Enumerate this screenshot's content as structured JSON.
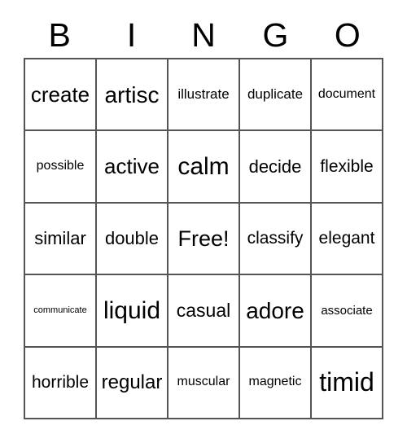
{
  "card": {
    "title_letters": [
      "B",
      "I",
      "N",
      "G",
      "O"
    ],
    "grid": {
      "columns": 5,
      "rows": 5,
      "border_color": "#555555",
      "background_color": "#ffffff",
      "text_color": "#000000",
      "cells": [
        [
          {
            "text": "create",
            "size": 26
          },
          {
            "text": "artisc",
            "size": 28
          },
          {
            "text": "illustrate",
            "size": 17
          },
          {
            "text": "duplicate",
            "size": 17
          },
          {
            "text": "document",
            "size": 16
          }
        ],
        [
          {
            "text": "possible",
            "size": 16
          },
          {
            "text": "active",
            "size": 26
          },
          {
            "text": "calm",
            "size": 30
          },
          {
            "text": "decide",
            "size": 22
          },
          {
            "text": "flexible",
            "size": 21
          }
        ],
        [
          {
            "text": "similar",
            "size": 22
          },
          {
            "text": "double",
            "size": 22
          },
          {
            "text": "Free!",
            "size": 27
          },
          {
            "text": "classify",
            "size": 21
          },
          {
            "text": "elegant",
            "size": 21
          }
        ],
        [
          {
            "text": "communicate",
            "size": 11
          },
          {
            "text": "liquid",
            "size": 30
          },
          {
            "text": "casual",
            "size": 23
          },
          {
            "text": "adore",
            "size": 28
          },
          {
            "text": "associate",
            "size": 15
          }
        ],
        [
          {
            "text": "horrible",
            "size": 21
          },
          {
            "text": "regular",
            "size": 24
          },
          {
            "text": "muscular",
            "size": 16
          },
          {
            "text": "magnetic",
            "size": 16
          },
          {
            "text": "timid",
            "size": 32
          }
        ]
      ]
    },
    "free_space": {
      "row": 2,
      "column": 2,
      "label": "Free!"
    }
  }
}
